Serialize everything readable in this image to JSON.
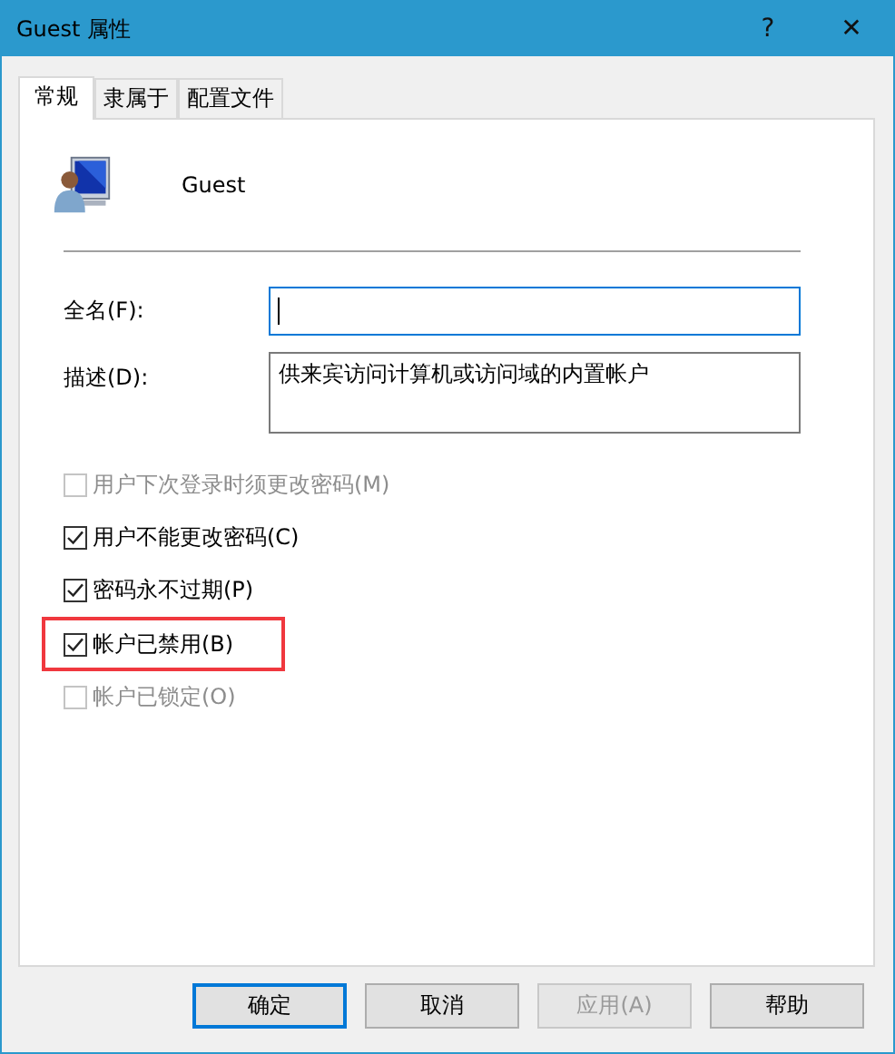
{
  "window": {
    "title": "Guest 属性",
    "help_button": "?",
    "close_button": "✕"
  },
  "tabs": [
    {
      "label": "常规",
      "selected": true
    },
    {
      "label": "隶属于",
      "selected": false
    },
    {
      "label": "配置文件",
      "selected": false
    }
  ],
  "user": {
    "name": "Guest"
  },
  "fields": [
    {
      "label": "全名(F):",
      "focused": true
    },
    {
      "label": "描述(D):",
      "value": "供来宾访问计算机或访问域的内置帐户",
      "focused": false
    }
  ],
  "options": [
    {
      "label": "用户下次登录时须更改密码(M)",
      "checked": false,
      "disabled": true,
      "highlighted": false
    },
    {
      "label": "用户不能更改密码(C)",
      "checked": true,
      "disabled": false,
      "highlighted": false
    },
    {
      "label": "密码永不过期(P)",
      "checked": true,
      "disabled": false,
      "highlighted": false
    },
    {
      "label": "帐户已禁用(B)",
      "checked": true,
      "disabled": false,
      "highlighted": true
    },
    {
      "label": "帐户已锁定(O)",
      "checked": false,
      "disabled": true,
      "highlighted": false
    }
  ],
  "buttons": [
    {
      "label": "确定",
      "default": true,
      "disabled": false
    },
    {
      "label": "取消",
      "default": false,
      "disabled": false
    },
    {
      "label": "应用(A)",
      "default": false,
      "disabled": true
    },
    {
      "label": "帮助",
      "default": false,
      "disabled": false
    }
  ]
}
